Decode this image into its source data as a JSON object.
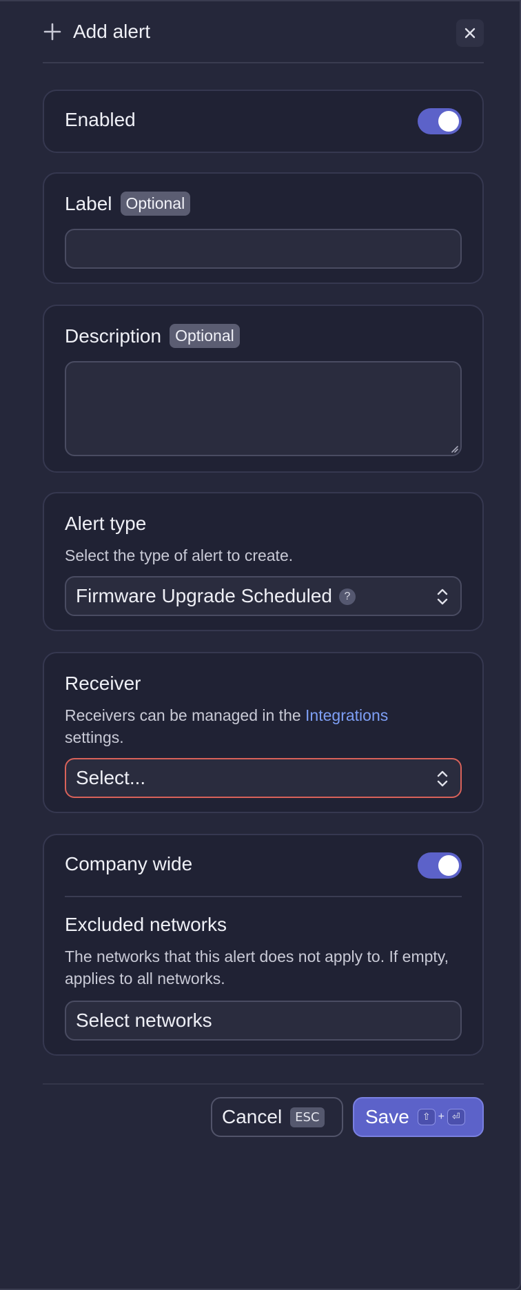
{
  "header": {
    "title": "Add alert"
  },
  "enabled": {
    "label": "Enabled",
    "on": true
  },
  "label_field": {
    "label": "Label",
    "badge": "Optional",
    "value": ""
  },
  "description_field": {
    "label": "Description",
    "badge": "Optional",
    "value": ""
  },
  "alert_type": {
    "label": "Alert type",
    "help": "Select the type of alert to create.",
    "selected": "Firmware Upgrade Scheduled",
    "help_mark": "?"
  },
  "receiver": {
    "label": "Receiver",
    "help_before": "Receivers can be managed in the ",
    "help_link": "Integrations",
    "help_after": "settings.",
    "placeholder": "Select..."
  },
  "company_wide": {
    "label": "Company wide",
    "on": true
  },
  "excluded_networks": {
    "label": "Excluded networks",
    "help": "The networks that this alert does not apply to. If empty, applies to all networks.",
    "placeholder": "Select networks"
  },
  "footer": {
    "cancel_label": "Cancel",
    "cancel_key": "ESC",
    "save_label": "Save",
    "save_key_shift": "⇧",
    "save_key_plus": "+",
    "save_key_enter": "⏎"
  },
  "colors": {
    "accent": "#5c62c9",
    "error_border": "#d9625a",
    "link": "#7e9ff5"
  }
}
